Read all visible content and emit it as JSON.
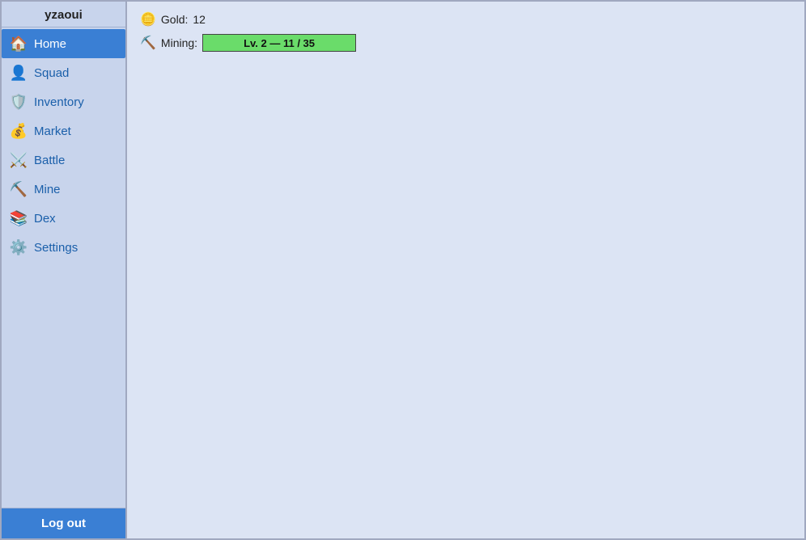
{
  "sidebar": {
    "username": "yzaoui",
    "nav_items": [
      {
        "id": "home",
        "label": "Home",
        "icon": "🏠",
        "active": true
      },
      {
        "id": "squad",
        "label": "Squad",
        "icon": "👤"
      },
      {
        "id": "inventory",
        "label": "Inventory",
        "icon": "🛡️"
      },
      {
        "id": "market",
        "label": "Market",
        "icon": "💰"
      },
      {
        "id": "battle",
        "label": "Battle",
        "icon": "⚔️"
      },
      {
        "id": "mine",
        "label": "Mine",
        "icon": "⛏️"
      },
      {
        "id": "dex",
        "label": "Dex",
        "icon": "📚"
      },
      {
        "id": "settings",
        "label": "Settings",
        "icon": "⚙️"
      }
    ],
    "logout_label": "Log out"
  },
  "main": {
    "gold_label": "Gold:",
    "gold_value": "12",
    "mining_label": "Mining:",
    "mining_bar_text": "Lv. 2 — 11 / 35",
    "mining_progress": 31
  }
}
